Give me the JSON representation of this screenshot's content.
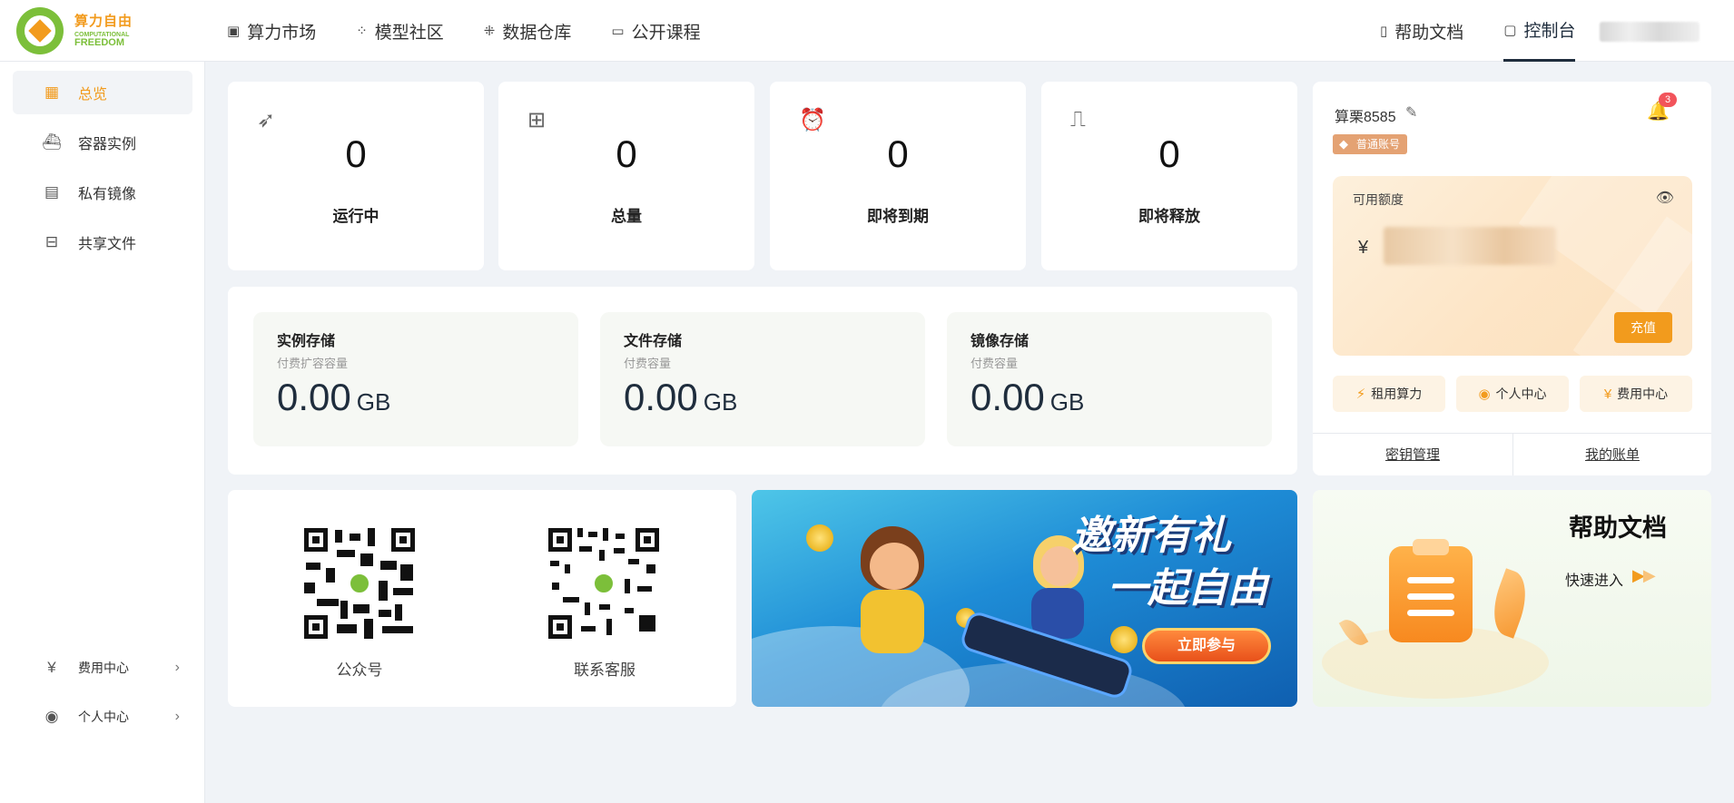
{
  "brand": {
    "cn": "算力自由",
    "en_line1": "COMPUTATIONAL",
    "en_line2": "FREEDOM"
  },
  "nav": [
    {
      "label": "算力市场",
      "icon": "chip-icon"
    },
    {
      "label": "模型社区",
      "icon": "dots-grid-icon"
    },
    {
      "label": "数据仓库",
      "icon": "network-icon"
    },
    {
      "label": "公开课程",
      "icon": "presentation-icon"
    }
  ],
  "nav_right": [
    {
      "label": "帮助文档",
      "icon": "book-icon"
    },
    {
      "label": "控制台",
      "icon": "monitor-icon",
      "active": true
    }
  ],
  "sidebar": {
    "items": [
      {
        "label": "总览",
        "icon": "dashboard-icon",
        "active": true
      },
      {
        "label": "容器实例",
        "icon": "container-ship-icon"
      },
      {
        "label": "私有镜像",
        "icon": "image-folder-icon"
      },
      {
        "label": "共享文件",
        "icon": "drive-icon"
      }
    ],
    "bottom": [
      {
        "label": "费用中心",
        "icon": "bill-icon"
      },
      {
        "label": "个人中心",
        "icon": "user-circle-icon"
      }
    ]
  },
  "stats": [
    {
      "value": "0",
      "label": "运行中",
      "icon": "rocket-icon"
    },
    {
      "value": "0",
      "label": "总量",
      "icon": "cpu-icon"
    },
    {
      "value": "0",
      "label": "即将到期",
      "icon": "alarm-clock-icon"
    },
    {
      "value": "0",
      "label": "即将释放",
      "icon": "shredder-icon"
    }
  ],
  "storage": [
    {
      "title": "实例存储",
      "subtitle": "付费扩容容量",
      "value": "0.00",
      "unit": "GB"
    },
    {
      "title": "文件存储",
      "subtitle": "付费容量",
      "value": "0.00",
      "unit": "GB"
    },
    {
      "title": "镜像存储",
      "subtitle": "付费容量",
      "value": "0.00",
      "unit": "GB"
    }
  ],
  "account": {
    "name": "算栗8585",
    "type": "普通账号",
    "notifications": "3",
    "balance_label": "可用额度",
    "currency": "¥",
    "recharge": "充值",
    "quick": [
      {
        "label": "租用算力",
        "icon": "lightning-icon"
      },
      {
        "label": "个人中心",
        "icon": "user-circle-icon"
      },
      {
        "label": "费用中心",
        "icon": "bill-icon"
      }
    ],
    "links": [
      "密钥管理",
      "我的账单"
    ]
  },
  "qr": [
    {
      "label": "公众号"
    },
    {
      "label": "联系客服"
    }
  ],
  "banner": {
    "title1": "邀新有礼",
    "title2": "一起自由",
    "cta": "立即参与"
  },
  "help": {
    "title": "帮助文档",
    "enter": "快速进入"
  },
  "colors": {
    "accent": "#f29b1d",
    "brand_green": "#7cbf3a",
    "page_bg": "#f0f3f7"
  }
}
